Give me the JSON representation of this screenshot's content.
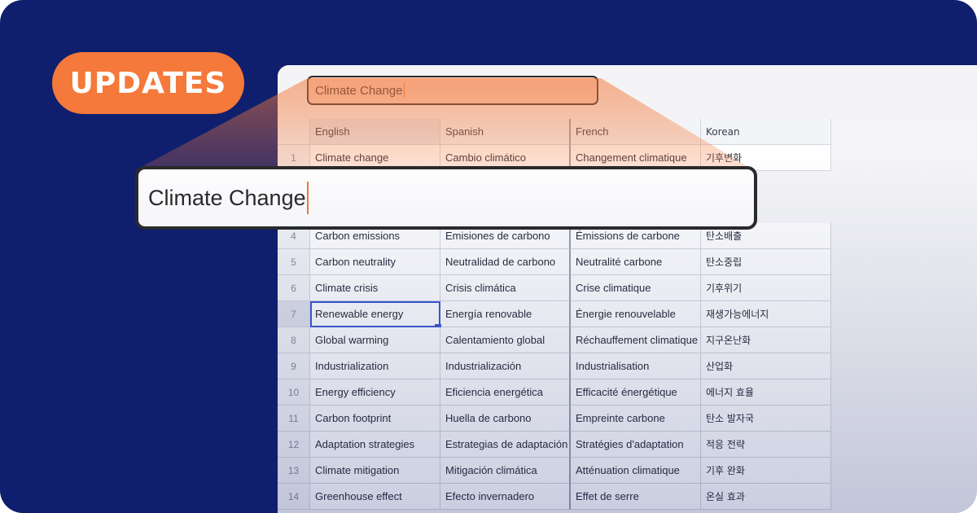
{
  "badge": {
    "label": "UPDATES"
  },
  "search": {
    "value": "Climate Change"
  },
  "zoomed_search": {
    "value": "Climate Change"
  },
  "colors": {
    "background": "#0f1f6e",
    "accent": "#f4793a",
    "selection": "#3b5bd6"
  },
  "table": {
    "headers": [
      "English",
      "Spanish",
      "French",
      "Korean"
    ],
    "rows": [
      {
        "num": "1",
        "en": "Climate change",
        "es": "Cambio climático",
        "fr": "Changement climatique",
        "ko": "기후변화"
      },
      {
        "num": "4",
        "en": "Carbon emissions",
        "es": "Emisiones de carbono",
        "fr": "Émissions de carbone",
        "ko": "탄소배출"
      },
      {
        "num": "5",
        "en": "Carbon neutrality",
        "es": "Neutralidad de carbono",
        "fr": "Neutralité carbone",
        "ko": "탄소중립"
      },
      {
        "num": "6",
        "en": "Climate crisis",
        "es": "Crisis climática",
        "fr": "Crise climatique",
        "ko": "기후위기"
      },
      {
        "num": "7",
        "en": "Renewable energy",
        "es": "Energía renovable",
        "fr": "Énergie renouvelable",
        "ko": "재생가능에너지"
      },
      {
        "num": "8",
        "en": "Global warming",
        "es": "Calentamiento global",
        "fr": "Réchauffement climatique",
        "ko": "지구온난화"
      },
      {
        "num": "9",
        "en": "Industrialization",
        "es": "Industrialización",
        "fr": "Industrialisation",
        "ko": "산업화"
      },
      {
        "num": "10",
        "en": "Energy efficiency",
        "es": "Eficiencia energética",
        "fr": "Efficacité énergétique",
        "ko": "에너지 효율"
      },
      {
        "num": "11",
        "en": "Carbon footprint",
        "es": "Huella de carbono",
        "fr": "Empreinte carbone",
        "ko": "탄소 발자국"
      },
      {
        "num": "12",
        "en": "Adaptation strategies",
        "es": "Estrategias de adaptación",
        "fr": "Stratégies d'adaptation",
        "ko": "적응 전략"
      },
      {
        "num": "13",
        "en": "Climate mitigation",
        "es": "Mitigación climática",
        "fr": "Atténuation climatique",
        "ko": "기후 완화"
      },
      {
        "num": "14",
        "en": "Greenhouse effect",
        "es": "Efecto invernadero",
        "fr": "Effet de serre",
        "ko": "온실 효과"
      }
    ]
  }
}
